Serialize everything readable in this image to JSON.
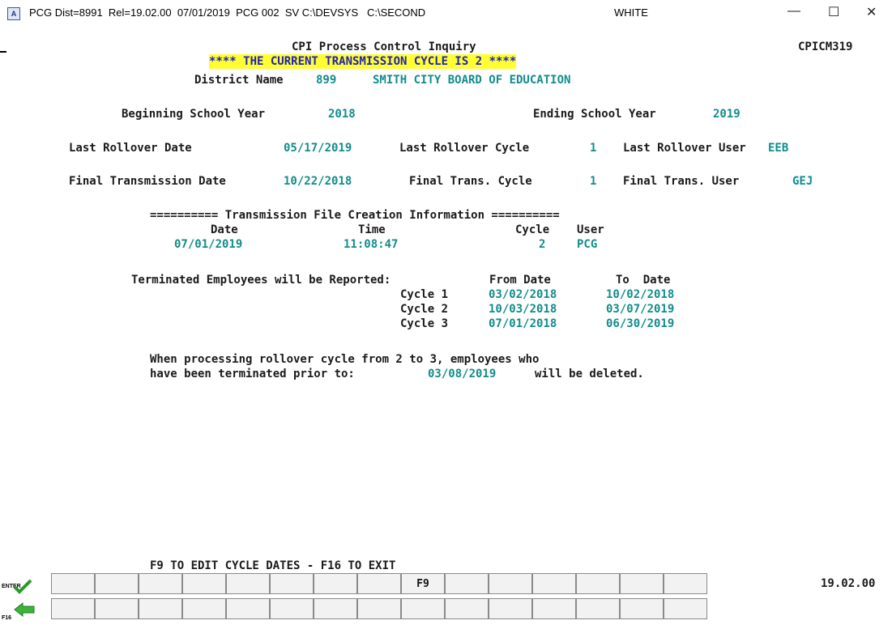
{
  "window": {
    "title": "PCG Dist=8991  Rel=19.02.00  07/01/2019  PCG 002  SV C:\\DEVSYS   C:\\SECOND",
    "user": "WHITE",
    "icon_letter": "A",
    "minimize": "—",
    "maximize": "☐",
    "close": "✕"
  },
  "screen": {
    "title": "CPI Process Control Inquiry",
    "screen_id": "CPICM319",
    "banner": "**** THE CURRENT TRANSMISSION CYCLE IS 2 ****",
    "district_label": "District Name",
    "district_number": "899",
    "district_name": "SMITH CITY BOARD OF EDUCATION",
    "beginning_year_label": "Beginning School Year",
    "beginning_year": "2018",
    "ending_year_label": "Ending School Year",
    "ending_year": "2019",
    "last_rollover_date_label": "Last Rollover Date",
    "last_rollover_date": "05/17/2019",
    "last_rollover_cycle_label": "Last Rollover Cycle",
    "last_rollover_cycle": "1",
    "last_rollover_user_label": "Last Rollover User",
    "last_rollover_user": "EEB",
    "final_trans_date_label": "Final Transmission Date",
    "final_trans_date": "10/22/2018",
    "final_trans_cycle_label": "Final Trans. Cycle",
    "final_trans_cycle": "1",
    "final_trans_user_label": "Final Trans. User",
    "final_trans_user": "GEJ",
    "file_creation_header": "========== Transmission File Creation Information ==========",
    "fc_date_label": "Date",
    "fc_time_label": "Time",
    "fc_cycle_label": "Cycle",
    "fc_user_label": "User",
    "fc_date": "07/01/2019",
    "fc_time": "11:08:47",
    "fc_cycle": "2",
    "fc_user": "PCG",
    "terminated_label": "Terminated Employees will be Reported:",
    "from_date_label": "From Date",
    "to_date_label": "To  Date",
    "cycles": [
      {
        "label": "Cycle 1",
        "from": "03/02/2018",
        "to": "10/02/2018"
      },
      {
        "label": "Cycle 2",
        "from": "10/03/2018",
        "to": "03/07/2019"
      },
      {
        "label": "Cycle 3",
        "from": "07/01/2018",
        "to": "06/30/2019"
      }
    ],
    "msg_line1": "When processing rollover cycle from 2 to 3, employees who",
    "msg_line2_a": "have been terminated prior to:",
    "msg_date": "03/08/2019",
    "msg_line2_b": "will be deleted.",
    "instructions": "F9 TO EDIT CYCLE DATES - F16 TO EXIT",
    "version": "19.02.00"
  },
  "function_keys": {
    "enter_label": "ENTER",
    "f16_label": "F16",
    "f9_label": "F9"
  },
  "colors": {
    "value": "#128c8c",
    "banner_bg": "#ffff33",
    "banner_text": "#2020c0"
  }
}
